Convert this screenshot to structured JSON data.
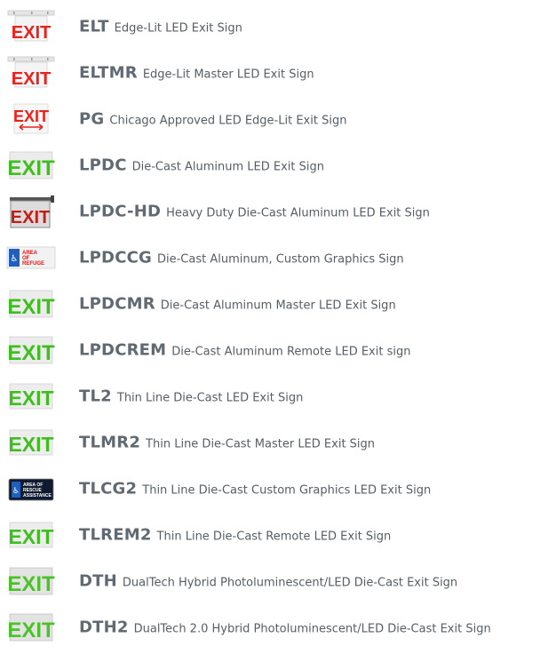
{
  "items": [
    {
      "code": "ELT",
      "desc": "Edge-Lit LED Exit Sign",
      "icon": "elt-exit-sign-icon"
    },
    {
      "code": "ELTMR",
      "desc": "Edge-Lit Master LED Exit Sign",
      "icon": "eltmr-exit-sign-icon"
    },
    {
      "code": "PG",
      "desc": "Chicago Approved LED Edge-Lit Exit Sign",
      "icon": "pg-exit-sign-icon"
    },
    {
      "code": "LPDC",
      "desc": "Die-Cast Aluminum LED Exit Sign",
      "icon": "lpdc-exit-sign-icon"
    },
    {
      "code": "LPDC-HD",
      "desc": "Heavy Duty Die-Cast Aluminum LED Exit Sign",
      "icon": "lpdc-hd-exit-sign-icon"
    },
    {
      "code": "LPDCCG",
      "desc": "Die-Cast Aluminum, Custom Graphics Sign",
      "icon": "lpdccg-refuge-sign-icon",
      "sign_text": [
        "AREA",
        "OF",
        "REFUGE"
      ]
    },
    {
      "code": "LPDCMR",
      "desc": "Die-Cast Aluminum Master LED Exit Sign",
      "icon": "lpdcmr-exit-sign-icon"
    },
    {
      "code": "LPDCREM",
      "desc": "Die-Cast Aluminum Remote LED Exit sign",
      "icon": "lpdcrem-exit-sign-icon"
    },
    {
      "code": "TL2",
      "desc": "Thin Line Die-Cast LED Exit Sign",
      "icon": "tl2-exit-sign-icon"
    },
    {
      "code": "TLMR2",
      "desc": "Thin Line Die-Cast Master LED Exit Sign",
      "icon": "tlmr2-exit-sign-icon"
    },
    {
      "code": "TLCG2",
      "desc": "Thin Line Die-Cast Custom Graphics LED Exit Sign",
      "icon": "tlcg2-assistance-sign-icon",
      "sign_text": [
        "AREA OF",
        "RESCUE",
        "ASSISTANCE"
      ]
    },
    {
      "code": "TLREM2",
      "desc": "Thin Line Die-Cast Remote LED Exit Sign",
      "icon": "tlrem2-exit-sign-icon"
    },
    {
      "code": "DTH",
      "desc": "DualTech Hybrid Photoluminescent/LED Die-Cast Exit Sign",
      "icon": "dth-exit-sign-icon"
    },
    {
      "code": "DTH2",
      "desc": "DualTech 2.0 Hybrid Photoluminescent/LED Die-Cast Exit Sign",
      "icon": "dth2-exit-sign-icon"
    }
  ],
  "sign_word": "EXIT",
  "colors": {
    "exit_red": "#e8231b",
    "exit_green": "#3fbf1f",
    "code_text": "#606a73",
    "desc_text": "#555e66"
  }
}
